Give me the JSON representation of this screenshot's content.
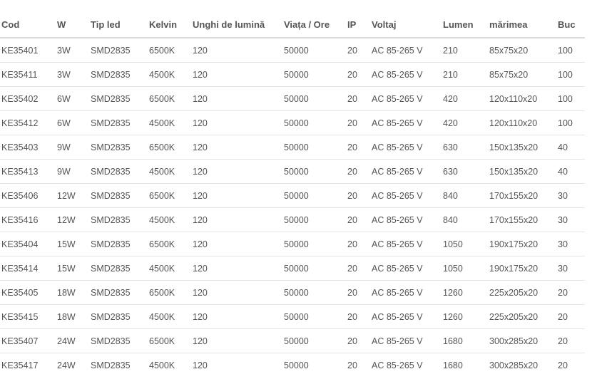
{
  "table": {
    "headers": [
      "Cod",
      "W",
      "Tip led",
      "Kelvin",
      "Unghi de lumină",
      "Viața / Ore",
      "IP",
      "Voltaj",
      "Lumen",
      "mărimea",
      "Buc"
    ],
    "rows": [
      [
        "KE35401",
        "3W",
        "SMD2835",
        "6500K",
        "120",
        "50000",
        "20",
        "AC 85-265 V",
        "210",
        "85x75x20",
        "100"
      ],
      [
        "KE35411",
        "3W",
        "SMD2835",
        "4500K",
        "120",
        "50000",
        "20",
        "AC 85-265 V",
        "210",
        "85x75x20",
        "100"
      ],
      [
        "KE35402",
        "6W",
        "SMD2835",
        "6500K",
        "120",
        "50000",
        "20",
        "AC 85-265 V",
        "420",
        "120x110x20",
        "100"
      ],
      [
        "KE35412",
        "6W",
        "SMD2835",
        "4500K",
        "120",
        "50000",
        "20",
        "AC 85-265 V",
        "420",
        "120x110x20",
        "100"
      ],
      [
        "KE35403",
        "9W",
        "SMD2835",
        "6500K",
        "120",
        "50000",
        "20",
        "AC 85-265 V",
        "630",
        "150x135x20",
        "40"
      ],
      [
        "KE35413",
        "9W",
        "SMD2835",
        "4500K",
        "120",
        "50000",
        "20",
        "AC 85-265 V",
        "630",
        "150x135x20",
        "40"
      ],
      [
        "KE35406",
        "12W",
        "SMD2835",
        "6500K",
        "120",
        "50000",
        "20",
        "AC 85-265 V",
        "840",
        "170x155x20",
        "30"
      ],
      [
        "KE35416",
        "12W",
        "SMD2835",
        "4500K",
        "120",
        "50000",
        "20",
        "AC 85-265 V",
        "840",
        "170x155x20",
        "30"
      ],
      [
        "KE35404",
        "15W",
        "SMD2835",
        "6500K",
        "120",
        "50000",
        "20",
        "AC 85-265 V",
        "1050",
        "190x175x20",
        "30"
      ],
      [
        "KE35414",
        "15W",
        "SMD2835",
        "4500K",
        "120",
        "50000",
        "20",
        "AC 85-265 V",
        "1050",
        "190x175x20",
        "30"
      ],
      [
        "KE35405",
        "18W",
        "SMD2835",
        "6500K",
        "120",
        "50000",
        "20",
        "AC 85-265 V",
        "1260",
        "225x205x20",
        "20"
      ],
      [
        "KE35415",
        "18W",
        "SMD2835",
        "4500K",
        "120",
        "50000",
        "20",
        "AC 85-265 V",
        "1260",
        "225x205x20",
        "20"
      ],
      [
        "KE35407",
        "24W",
        "SMD2835",
        "6500K",
        "120",
        "50000",
        "20",
        "AC 85-265 V",
        "1680",
        "300x285x20",
        "20"
      ],
      [
        "KE35417",
        "24W",
        "SMD2835",
        "4500K",
        "120",
        "50000",
        "20",
        "AC 85-265 V",
        "1680",
        "300x285x20",
        "20"
      ]
    ]
  },
  "colors": {
    "text": "#555555",
    "header_rule": "#d9d9d9",
    "row_rule": "#e4e4e4",
    "background": "#ffffff"
  }
}
